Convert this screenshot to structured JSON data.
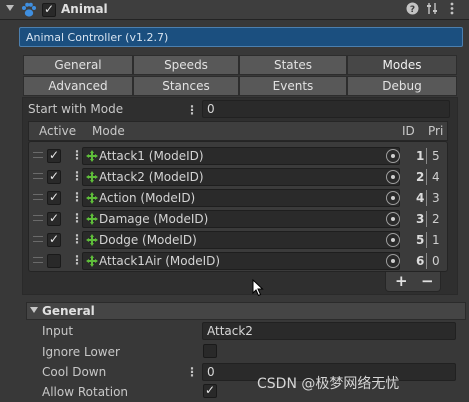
{
  "header": {
    "title": "Animal",
    "enabled": true,
    "icons": [
      "paw-icon",
      "help-icon",
      "presets-icon",
      "more-icon"
    ]
  },
  "banner": {
    "text": "Animal Controller (v1.2.7)"
  },
  "tabs_row1": [
    "General",
    "Speeds",
    "States",
    "Modes"
  ],
  "tabs_row2": [
    "Advanced",
    "Stances",
    "Events",
    "Debug"
  ],
  "selected_tab": "Modes",
  "start_with_mode": {
    "label": "Start with Mode",
    "value": "0"
  },
  "modes_list": {
    "headers": {
      "active": "Active",
      "mode": "Mode",
      "id": "ID",
      "pri": "Pri"
    },
    "rows": [
      {
        "active": true,
        "mode": "Attack1 (ModeID)",
        "id": "1",
        "pri": "5"
      },
      {
        "active": true,
        "mode": "Attack2 (ModeID)",
        "id": "2",
        "pri": "4"
      },
      {
        "active": true,
        "mode": "Action (ModeID)",
        "id": "4",
        "pri": "3"
      },
      {
        "active": true,
        "mode": "Damage (ModeID)",
        "id": "3",
        "pri": "2"
      },
      {
        "active": true,
        "mode": "Dodge (ModeID)",
        "id": "5",
        "pri": "1"
      },
      {
        "active": false,
        "mode": "Attack1Air (ModeID)",
        "id": "6",
        "pri": "0"
      }
    ],
    "add_label": "+",
    "remove_label": "−"
  },
  "general_section": {
    "title": "General",
    "input_label": "Input",
    "input_value": "Attack2",
    "ignore_lower_label": "Ignore Lower",
    "ignore_lower": false,
    "cool_down_label": "Cool Down",
    "cool_down_value": "0",
    "allow_rotation_label": "Allow Rotation",
    "allow_rotation": true
  },
  "watermark": "CSDN @极梦网络无忧",
  "colors": {
    "banner": "#1b4f7f",
    "icon_green": "#5fbf3a",
    "paw_blue": "#3f8fe0"
  }
}
